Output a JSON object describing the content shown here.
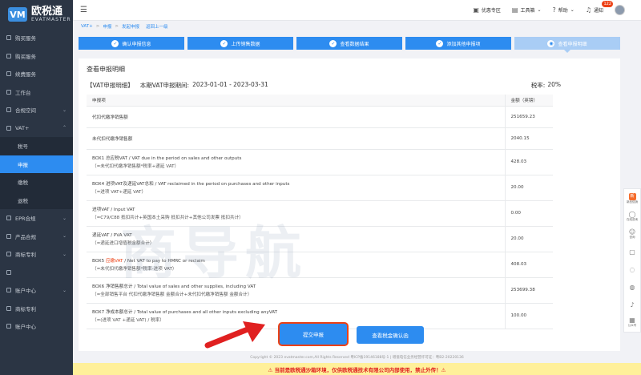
{
  "brand": {
    "name": "欧税通",
    "sub": "EVATMASTER",
    "mark": "VM"
  },
  "sidebar": {
    "items": [
      {
        "label": "购买服务",
        "type": "top"
      },
      {
        "label": "购买服务",
        "type": "top"
      },
      {
        "label": "续费服务",
        "type": "top"
      },
      {
        "label": "工作台",
        "type": "top"
      },
      {
        "label": "合规空间",
        "type": "top",
        "arrow": "⌄"
      },
      {
        "label": "VAT+",
        "type": "top",
        "arrow": "⌃"
      },
      {
        "label": "税号",
        "type": "sub"
      },
      {
        "label": "申报",
        "type": "sub",
        "active": true
      },
      {
        "label": "缴税",
        "type": "sub"
      },
      {
        "label": "退税",
        "type": "sub"
      },
      {
        "label": "EPR合规",
        "type": "top",
        "arrow": "⌄"
      },
      {
        "label": "产品合规",
        "type": "top",
        "arrow": "⌄"
      },
      {
        "label": "商标专利",
        "type": "top",
        "arrow": "⌄"
      },
      {
        "label": "",
        "type": "top"
      },
      {
        "label": "账户中心",
        "type": "top",
        "arrow": "⌄"
      },
      {
        "label": "商标专利",
        "type": "top"
      },
      {
        "label": "账户中心",
        "type": "top"
      }
    ]
  },
  "header": {
    "menu_icon": "menu-icon",
    "items": [
      {
        "label": "优惠专区",
        "icon": "gift-icon",
        "sym": "▣"
      },
      {
        "label": "工具箱",
        "icon": "toolbox-icon",
        "sym": "▤",
        "arrow": "⌄"
      },
      {
        "label": "帮助",
        "icon": "help-icon",
        "sym": "?",
        "arrow": "⌄"
      },
      {
        "label": "通知",
        "icon": "bell-icon",
        "sym": "♫",
        "badge": "122"
      }
    ]
  },
  "breadcrumb": [
    "VAT+",
    "申报",
    "发起申报",
    "返回上一级"
  ],
  "steps": [
    {
      "label": "确认申报信息",
      "done": true
    },
    {
      "label": "上传销售数据",
      "done": true
    },
    {
      "label": "查看数据结果",
      "done": true
    },
    {
      "label": "添加其他申报项",
      "done": true
    },
    {
      "label": "查看申报明细",
      "done": false,
      "current": true
    }
  ],
  "card": {
    "title": "查看申报明细",
    "summary_label": "【VAT申报明细】",
    "period_label": "本期VAT申报期间:",
    "period": "2023-01-01 - 2023-03-31",
    "rate_label": "税率:",
    "rate": "20%",
    "table": {
      "headers": [
        "申报项",
        "金额（英镑）"
      ],
      "rows": [
        {
          "label": "代扣代缴净销售额",
          "amount": "251659.23"
        },
        {
          "label": "未代扣代缴净销售额",
          "amount": "2040.15"
        },
        {
          "label": "BOX1 总应税VAT / VAT due in the period on sales and other outputs",
          "line2": "（=未代扣代缴净销售额*税率+递延 VAT）",
          "amount": "428.03"
        },
        {
          "label": "BOX4 进项VAT及递延VAT总和 / VAT reclaimed in the period on purchases and other inputs",
          "line2": "（=进项 VAT+递延 VAT）",
          "amount": "20.00"
        },
        {
          "label": "进项VAT / Input VAT",
          "line2": "（=C79/C88 抵扣共计+英国本土采购 抵扣共计+其他公司发票 抵扣共计）",
          "amount": "0.00"
        },
        {
          "label": "递延VAT / PVA VAT",
          "line2": "（=递延进口增值税金额合计）",
          "amount": "20.00"
        },
        {
          "label_pre": "BOX5 ",
          "label_hl": "应缴VAT",
          "label_post": " / Net VAT to pay to HMRC or reclaim",
          "line2": "（=未代扣代缴净销售额*税率-进项 VAT）",
          "amount": "408.03"
        },
        {
          "label": "BOX6 净销售额总计 / Total value of sales and other supplies, including VAT",
          "line2": "（=全部销售平台 代扣代缴净销售额 金额合计+未代扣代缴净销售额 金额合计）",
          "amount": "253699.38"
        },
        {
          "label": "BOX7 净成本额总计 / Total value of purchases and all other inputs excluding anyVAT",
          "line2": "（=(进项 VAT +递延 VAT) / 税率）",
          "amount": "100.00"
        }
      ]
    }
  },
  "buttons": {
    "submit": "提交申报",
    "confirm": "查看税金确认函"
  },
  "copyright": "Copyright © 2023 evatmaster.com,All Rights Reserved 粤ICP备19146188号-1 | 增值电信业务经营许可证：粤B2-20220136",
  "banner": "⚠ 当前是欧税通沙箱环境，仅供欧税通技术有限公司内部使用，禁止外传！⚠",
  "watermark": "商导航",
  "rightbar": [
    {
      "label": "新品促销",
      "icon": "promo-icon",
      "sym": "新",
      "hot": true
    },
    {
      "label": "在线咨询",
      "icon": "chat-icon",
      "sym": "◯"
    },
    {
      "label": "咨询",
      "icon": "qq-icon",
      "sym": "☺"
    },
    {
      "label": "",
      "icon": "message-icon",
      "sym": "▢"
    },
    {
      "label": "",
      "icon": "comment-icon",
      "sym": "◌"
    },
    {
      "label": "",
      "icon": "service-icon",
      "sym": "◍"
    },
    {
      "label": "",
      "icon": "headset-icon",
      "sym": "♪"
    },
    {
      "label": "公众号",
      "icon": "qrcode-icon",
      "sym": "▦"
    }
  ]
}
